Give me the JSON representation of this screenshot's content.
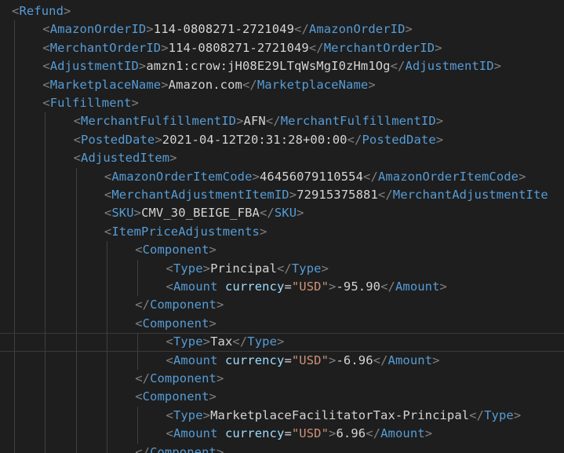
{
  "editor": {
    "language": "xml",
    "current_line_index": 18,
    "lines": [
      {
        "indent": 0,
        "kind": "open",
        "tag": "Refund"
      },
      {
        "indent": 1,
        "kind": "element",
        "tag": "AmazonOrderID",
        "text": "114-0808271-2721049"
      },
      {
        "indent": 1,
        "kind": "element",
        "tag": "MerchantOrderID",
        "text": "114-0808271-2721049"
      },
      {
        "indent": 1,
        "kind": "element",
        "tag": "AdjustmentID",
        "text": "amzn1:crow:jH08E29LTqWsMgI0zHm1Og"
      },
      {
        "indent": 1,
        "kind": "element",
        "tag": "MarketplaceName",
        "text": "Amazon.com"
      },
      {
        "indent": 1,
        "kind": "open",
        "tag": "Fulfillment"
      },
      {
        "indent": 2,
        "kind": "element",
        "tag": "MerchantFulfillmentID",
        "text": "AFN"
      },
      {
        "indent": 2,
        "kind": "element",
        "tag": "PostedDate",
        "text": "2021-04-12T20:31:28+00:00"
      },
      {
        "indent": 2,
        "kind": "open",
        "tag": "AdjustedItem"
      },
      {
        "indent": 3,
        "kind": "element",
        "tag": "AmazonOrderItemCode",
        "text": "46456079110554"
      },
      {
        "indent": 3,
        "kind": "element",
        "tag": "MerchantAdjustmentItemID",
        "text": "72915375881",
        "close_partial": "MerchantAdjustmentIte"
      },
      {
        "indent": 3,
        "kind": "element",
        "tag": "SKU",
        "text": "CMV_30_BEIGE_FBA"
      },
      {
        "indent": 3,
        "kind": "open",
        "tag": "ItemPriceAdjustments"
      },
      {
        "indent": 4,
        "kind": "open",
        "tag": "Component"
      },
      {
        "indent": 5,
        "kind": "element",
        "tag": "Type",
        "text": "Principal"
      },
      {
        "indent": 5,
        "kind": "element_attr",
        "tag": "Amount",
        "attr": "currency",
        "attr_value": "\"USD\"",
        "text": "-95.90"
      },
      {
        "indent": 4,
        "kind": "close",
        "tag": "Component"
      },
      {
        "indent": 4,
        "kind": "open",
        "tag": "Component"
      },
      {
        "indent": 5,
        "kind": "element",
        "tag": "Type",
        "text": "Tax"
      },
      {
        "indent": 5,
        "kind": "element_attr",
        "tag": "Amount",
        "attr": "currency",
        "attr_value": "\"USD\"",
        "text": "-6.96"
      },
      {
        "indent": 4,
        "kind": "close",
        "tag": "Component"
      },
      {
        "indent": 4,
        "kind": "open",
        "tag": "Component"
      },
      {
        "indent": 5,
        "kind": "element",
        "tag": "Type",
        "text": "MarketplaceFacilitatorTax-Principal"
      },
      {
        "indent": 5,
        "kind": "element_attr",
        "tag": "Amount",
        "attr": "currency",
        "attr_value": "\"USD\"",
        "text": "6.96"
      },
      {
        "indent": 4,
        "kind": "close",
        "tag": "Component"
      }
    ]
  },
  "colors": {
    "background": "#1e1e1e",
    "bracket": "#808080",
    "tag": "#569cd6",
    "attribute": "#9cdcfe",
    "string": "#ce9178",
    "text": "#d4d4d4",
    "indent_guide": "#404040",
    "current_line_border": "#3a3a3a"
  }
}
